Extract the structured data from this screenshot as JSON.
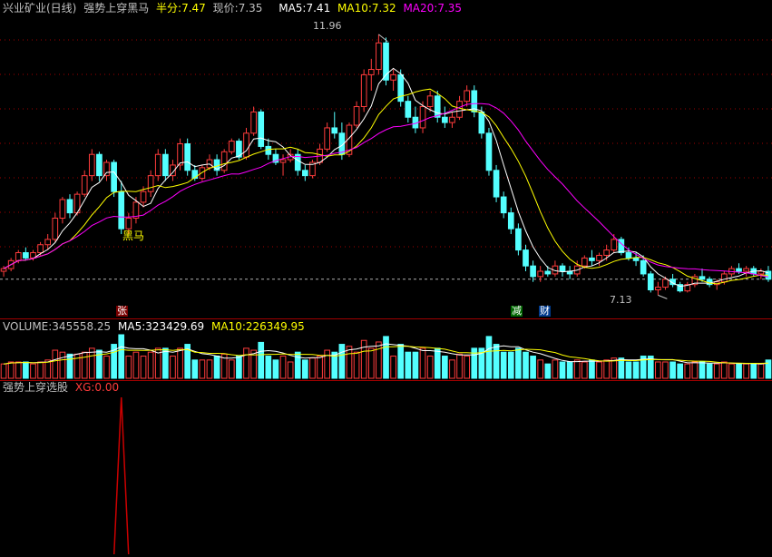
{
  "header": {
    "stock_title": "兴业矿业(日线)",
    "formula_name": "强势上穿黑马",
    "half_label": "半分:",
    "half_value": "7.47",
    "price_label": "现价:",
    "price_value": "7.35",
    "ma5_label": "MA5:",
    "ma5_value": "7.41",
    "ma10_label": "MA10:",
    "ma10_value": "7.32",
    "ma20_label": "MA20:",
    "ma20_value": "7.35"
  },
  "price_chart": {
    "high_label": "11.96",
    "low_label": "7.13",
    "signal_label": "黑马",
    "tags": {
      "zhang": "张",
      "jian": "减",
      "cai": "财"
    }
  },
  "volume_header": {
    "volume_label": "VOLUME:",
    "volume_value": "345558.25",
    "ma5_label": "MA5:",
    "ma5_value": "323429.69",
    "ma10_label": "MA10:",
    "ma10_value": "226349.95"
  },
  "indicator_header": {
    "name": "强势上穿选股",
    "xg_label": "XG:",
    "xg_value": "0.00"
  },
  "colors": {
    "up": "#ff3c3c",
    "down": "#54ffff",
    "ma5": "#ffffff",
    "ma10": "#ffff00",
    "ma20": "#ff00ff",
    "grid": "#a00000",
    "signal": "#cc0000"
  },
  "chart_data": {
    "type": "candlestick",
    "ylim": [
      6.8,
      12.3
    ],
    "candles": [
      [
        7.5,
        7.6,
        7.4,
        7.55
      ],
      [
        7.55,
        7.75,
        7.5,
        7.7
      ],
      [
        7.7,
        7.9,
        7.65,
        7.85
      ],
      [
        7.85,
        7.95,
        7.7,
        7.75
      ],
      [
        7.75,
        7.9,
        7.7,
        7.85
      ],
      [
        7.85,
        8.05,
        7.8,
        8.0
      ],
      [
        8.0,
        8.2,
        7.9,
        8.1
      ],
      [
        8.1,
        8.6,
        8.05,
        8.5
      ],
      [
        8.5,
        8.9,
        8.4,
        8.85
      ],
      [
        8.85,
        8.95,
        8.5,
        8.6
      ],
      [
        8.6,
        9.0,
        8.55,
        8.95
      ],
      [
        8.95,
        9.4,
        8.9,
        9.3
      ],
      [
        9.3,
        9.8,
        9.2,
        9.7
      ],
      [
        9.7,
        9.75,
        9.2,
        9.3
      ],
      [
        9.3,
        9.6,
        9.2,
        9.55
      ],
      [
        9.55,
        9.6,
        8.9,
        9.0
      ],
      [
        9.0,
        9.2,
        8.2,
        8.3
      ],
      [
        8.3,
        8.6,
        8.2,
        8.5
      ],
      [
        8.5,
        8.9,
        8.4,
        8.8
      ],
      [
        8.8,
        9.1,
        8.7,
        9.0
      ],
      [
        9.0,
        9.4,
        8.9,
        9.3
      ],
      [
        9.3,
        9.8,
        9.2,
        9.7
      ],
      [
        9.7,
        9.8,
        9.2,
        9.3
      ],
      [
        9.3,
        9.6,
        9.2,
        9.5
      ],
      [
        9.5,
        10.0,
        9.4,
        9.9
      ],
      [
        9.9,
        10.0,
        9.3,
        9.4
      ],
      [
        9.4,
        9.5,
        9.2,
        9.25
      ],
      [
        9.25,
        9.5,
        9.2,
        9.45
      ],
      [
        9.45,
        9.7,
        9.4,
        9.6
      ],
      [
        9.6,
        9.7,
        9.3,
        9.4
      ],
      [
        9.4,
        9.8,
        9.35,
        9.75
      ],
      [
        9.75,
        10.0,
        9.7,
        9.95
      ],
      [
        9.95,
        10.0,
        9.6,
        9.65
      ],
      [
        9.65,
        10.2,
        9.6,
        10.1
      ],
      [
        10.1,
        10.6,
        10.05,
        10.5
      ],
      [
        10.5,
        10.55,
        9.8,
        9.85
      ],
      [
        9.85,
        10.0,
        9.6,
        9.7
      ],
      [
        9.7,
        9.8,
        9.5,
        9.55
      ],
      [
        9.55,
        9.7,
        9.3,
        9.6
      ],
      [
        9.6,
        9.8,
        9.55,
        9.7
      ],
      [
        9.7,
        9.8,
        9.3,
        9.4
      ],
      [
        9.4,
        9.5,
        9.2,
        9.3
      ],
      [
        9.3,
        9.6,
        9.25,
        9.55
      ],
      [
        9.55,
        9.9,
        9.5,
        9.8
      ],
      [
        9.8,
        10.3,
        9.75,
        10.2
      ],
      [
        10.2,
        10.5,
        10.0,
        10.1
      ],
      [
        10.1,
        10.3,
        9.6,
        9.7
      ],
      [
        9.7,
        10.3,
        9.65,
        10.25
      ],
      [
        10.25,
        10.7,
        10.2,
        10.6
      ],
      [
        10.6,
        11.3,
        10.5,
        11.2
      ],
      [
        11.2,
        11.5,
        10.9,
        11.3
      ],
      [
        11.3,
        11.96,
        11.2,
        11.8
      ],
      [
        11.8,
        11.9,
        11.0,
        11.1
      ],
      [
        11.1,
        11.3,
        10.9,
        11.2
      ],
      [
        11.2,
        11.3,
        10.6,
        10.7
      ],
      [
        10.7,
        10.8,
        10.3,
        10.4
      ],
      [
        10.4,
        10.6,
        10.1,
        10.2
      ],
      [
        10.2,
        10.7,
        10.1,
        10.6
      ],
      [
        10.6,
        10.9,
        10.5,
        10.8
      ],
      [
        10.8,
        10.9,
        10.3,
        10.4
      ],
      [
        10.4,
        10.6,
        10.2,
        10.3
      ],
      [
        10.3,
        10.5,
        10.2,
        10.4
      ],
      [
        10.4,
        10.8,
        10.35,
        10.7
      ],
      [
        10.7,
        11.0,
        10.6,
        10.9
      ],
      [
        10.9,
        11.0,
        10.4,
        10.5
      ],
      [
        10.5,
        10.6,
        10.0,
        10.1
      ],
      [
        10.1,
        10.2,
        9.3,
        9.4
      ],
      [
        9.4,
        9.5,
        8.8,
        8.9
      ],
      [
        8.9,
        9.0,
        8.5,
        8.6
      ],
      [
        8.6,
        8.7,
        8.2,
        8.3
      ],
      [
        8.3,
        8.4,
        7.8,
        7.9
      ],
      [
        7.9,
        8.0,
        7.5,
        7.6
      ],
      [
        7.6,
        7.7,
        7.3,
        7.4
      ],
      [
        7.4,
        7.6,
        7.3,
        7.5
      ],
      [
        7.5,
        7.6,
        7.4,
        7.45
      ],
      [
        7.45,
        7.7,
        7.4,
        7.6
      ],
      [
        7.6,
        7.65,
        7.4,
        7.5
      ],
      [
        7.5,
        7.6,
        7.35,
        7.45
      ],
      [
        7.45,
        7.7,
        7.4,
        7.6
      ],
      [
        7.6,
        7.8,
        7.55,
        7.75
      ],
      [
        7.75,
        7.9,
        7.6,
        7.7
      ],
      [
        7.7,
        7.85,
        7.6,
        7.8
      ],
      [
        7.8,
        8.0,
        7.7,
        7.9
      ],
      [
        7.9,
        8.2,
        7.85,
        8.1
      ],
      [
        8.1,
        8.15,
        7.8,
        7.85
      ],
      [
        7.85,
        7.95,
        7.7,
        7.75
      ],
      [
        7.75,
        7.85,
        7.6,
        7.7
      ],
      [
        7.7,
        7.8,
        7.4,
        7.45
      ],
      [
        7.45,
        7.5,
        7.1,
        7.15
      ],
      [
        7.15,
        7.3,
        7.05,
        7.2
      ],
      [
        7.2,
        7.4,
        7.15,
        7.35
      ],
      [
        7.35,
        7.45,
        7.2,
        7.25
      ],
      [
        7.25,
        7.3,
        7.1,
        7.13
      ],
      [
        7.13,
        7.3,
        7.1,
        7.25
      ],
      [
        7.25,
        7.45,
        7.2,
        7.4
      ],
      [
        7.4,
        7.55,
        7.3,
        7.35
      ],
      [
        7.35,
        7.4,
        7.2,
        7.25
      ],
      [
        7.25,
        7.35,
        7.15,
        7.3
      ],
      [
        7.3,
        7.5,
        7.25,
        7.45
      ],
      [
        7.45,
        7.6,
        7.4,
        7.55
      ],
      [
        7.55,
        7.65,
        7.45,
        7.5
      ],
      [
        7.5,
        7.6,
        7.4,
        7.55
      ],
      [
        7.55,
        7.6,
        7.4,
        7.45
      ],
      [
        7.45,
        7.55,
        7.35,
        7.5
      ],
      [
        7.5,
        7.6,
        7.3,
        7.35
      ]
    ],
    "volume_ylim": [
      0,
      400000
    ],
    "indicator_ylim": [
      0,
      1
    ],
    "xg_signal_index": 16
  }
}
